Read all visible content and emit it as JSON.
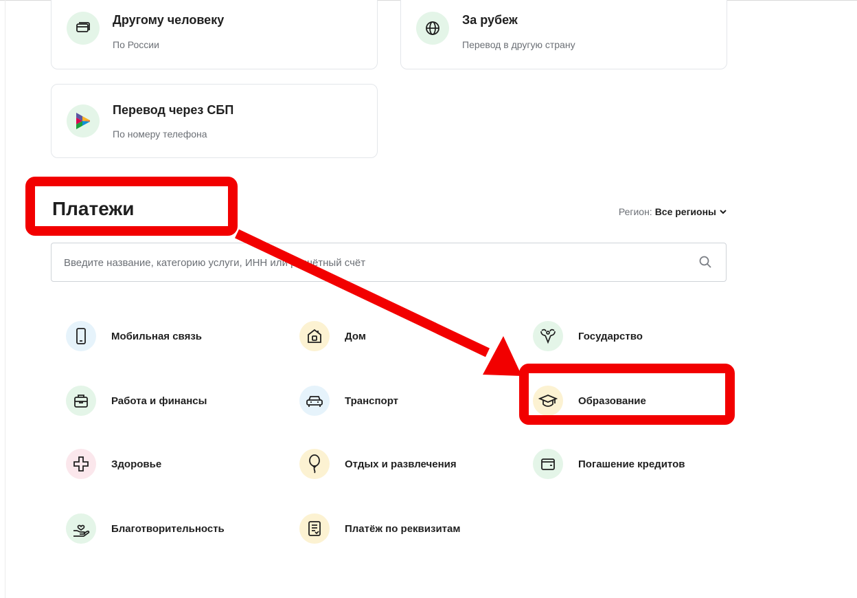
{
  "transfers": {
    "other_person": {
      "title": "Другому человеку",
      "subtitle": "По России",
      "icon": "card-icon"
    },
    "abroad": {
      "title": "За рубеж",
      "subtitle": "Перевод в другую страну",
      "icon": "globe-icon"
    },
    "sbp": {
      "title": "Перевод через СБП",
      "subtitle": "По номеру телефона",
      "icon": "sbp-logo-icon"
    }
  },
  "payments": {
    "title": "Платежи",
    "region_label": "Регион:",
    "region_value": "Все регионы",
    "search_placeholder": "Введите название, категорию услуги, ИНН или расчётный счёт",
    "categories": [
      {
        "label": "Мобильная связь",
        "icon": "phone-icon"
      },
      {
        "label": "Дом",
        "icon": "house-icon"
      },
      {
        "label": "Государство",
        "icon": "state-emblem-icon"
      },
      {
        "label": "Работа и финансы",
        "icon": "briefcase-icon"
      },
      {
        "label": "Транспорт",
        "icon": "car-icon"
      },
      {
        "label": "Образование",
        "icon": "graduation-cap-icon"
      },
      {
        "label": "Здоровье",
        "icon": "medical-cross-icon"
      },
      {
        "label": "Отдых и развлечения",
        "icon": "balloon-icon"
      },
      {
        "label": "Погашение кредитов",
        "icon": "wallet-icon"
      },
      {
        "label": "Благотворительность",
        "icon": "charity-hand-icon"
      },
      {
        "label": "Платёж по реквизитам",
        "icon": "document-icon"
      }
    ]
  },
  "annotation": {
    "highlight_color": "#f20000"
  },
  "colors": {
    "accent_green": "#21a038",
    "icon_bg_green": "#e4f5e8",
    "icon_bg_blue": "#e6f3fb",
    "icon_bg_yellow": "#fcf2d2",
    "icon_bg_pink": "#fbe7ec"
  }
}
